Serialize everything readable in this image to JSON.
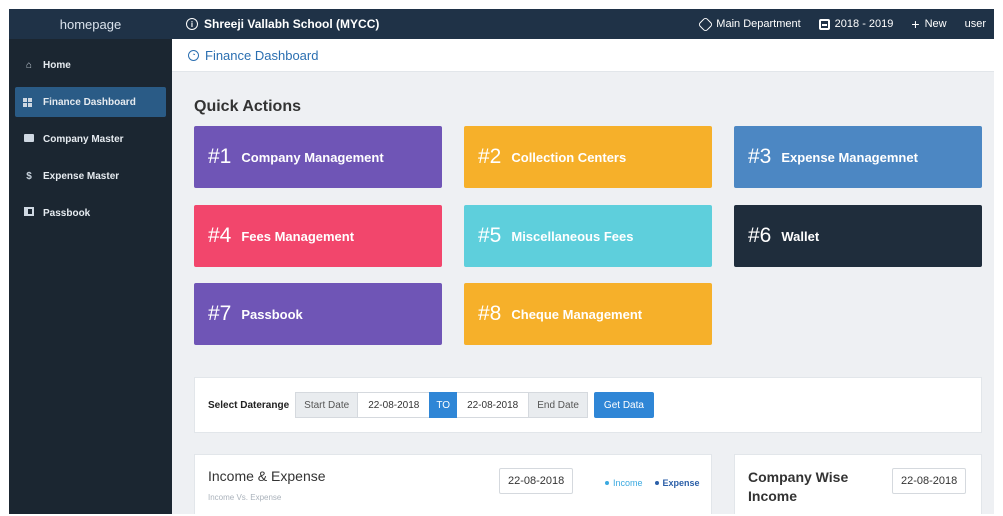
{
  "topbar": {
    "brand": "homepage",
    "school": "Shreeji Vallabh School (MYCC)",
    "department": "Main Department",
    "year": "2018 - 2019",
    "new_label": "New",
    "user": "user"
  },
  "sidebar": {
    "items": [
      {
        "label": "Home",
        "icon": "home-icon"
      },
      {
        "label": "Finance Dashboard",
        "icon": "dashboard-icon"
      },
      {
        "label": "Company Master",
        "icon": "briefcase-icon"
      },
      {
        "label": "Expense Master",
        "icon": "dollar-icon"
      },
      {
        "label": "Passbook",
        "icon": "book-icon"
      }
    ]
  },
  "breadcrumb": {
    "title": "Finance Dashboard"
  },
  "quick_actions": {
    "title": "Quick Actions",
    "tiles": [
      {
        "num": "#1",
        "label": "Company Management",
        "color": "#6f55b6"
      },
      {
        "num": "#2",
        "label": "Collection Centers",
        "color": "#f6b02a"
      },
      {
        "num": "#3",
        "label": "Expense Managemnet",
        "color": "#4c87c3"
      },
      {
        "num": "#4",
        "label": "Fees Management",
        "color": "#f2466c"
      },
      {
        "num": "#5",
        "label": "Miscellaneous Fees",
        "color": "#5ecfdc"
      },
      {
        "num": "#6",
        "label": "Wallet",
        "color": "#1f2d3c"
      },
      {
        "num": "#7",
        "label": "Passbook",
        "color": "#6f55b6"
      },
      {
        "num": "#8",
        "label": "Cheque Management",
        "color": "#f6b02a"
      }
    ]
  },
  "daterange": {
    "label": "Select Daterange",
    "start_label": "Start Date",
    "start_value": "22-08-2018",
    "to_label": "TO",
    "end_value": "22-08-2018",
    "end_label": "End Date",
    "button": "Get Data"
  },
  "income_expense": {
    "title": "Income & Expense",
    "subtitle": "Income Vs. Expense",
    "date": "22-08-2018",
    "legend": [
      {
        "label": "Income",
        "color": "#3aa9e0"
      },
      {
        "label": "Expense",
        "color": "#2b5fa8"
      }
    ]
  },
  "company_income": {
    "title_line1": "Company Wise",
    "title_line2": "Income",
    "date": "22-08-2018"
  }
}
